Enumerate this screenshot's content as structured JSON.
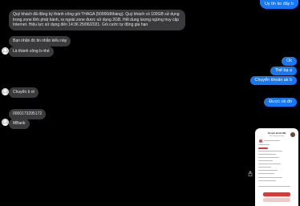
{
  "messages": [
    {
      "dir": "out",
      "text": "Uy tín ko đấy b"
    },
    {
      "dir": "in",
      "text": "Quý khách đã đăng ký thành công gói THAGA (50000đ/tháng). Quý khách có 100GB sử dụng trong zone tỉnh phát hành, ra ngoài zone được sử dụng 2GB. Hết dung lượng ngừng truy cập Internet. Hiệu lực sử dụng đến 14:36 25/06/2021. Gói cước tự động gia hạn"
    },
    {
      "dir": "in",
      "text": "Bạn nhận đc tin nhắn kiểu này"
    },
    {
      "dir": "in",
      "text": "Là thành công b nhé"
    },
    {
      "dir": "out",
      "text": "Ok"
    },
    {
      "dir": "out",
      "text": "Thế bạ ạ"
    },
    {
      "dir": "out",
      "text": "Chuyển khoản ak b"
    },
    {
      "dir": "out",
      "text": "Được rồi đó"
    },
    {
      "dir": "in",
      "text": "Chuyển b ơi"
    },
    {
      "dir": "in",
      "text": "0000173295172"
    },
    {
      "dir": "in",
      "text": "MBank"
    }
  ],
  "preview": {
    "title": "Chuyển khoản MB",
    "subtitle": "Xác nhận giao dịch"
  },
  "colors": {
    "background": "#000000",
    "incoming": "#3a3a3c",
    "outgoing": "#1877f2"
  }
}
